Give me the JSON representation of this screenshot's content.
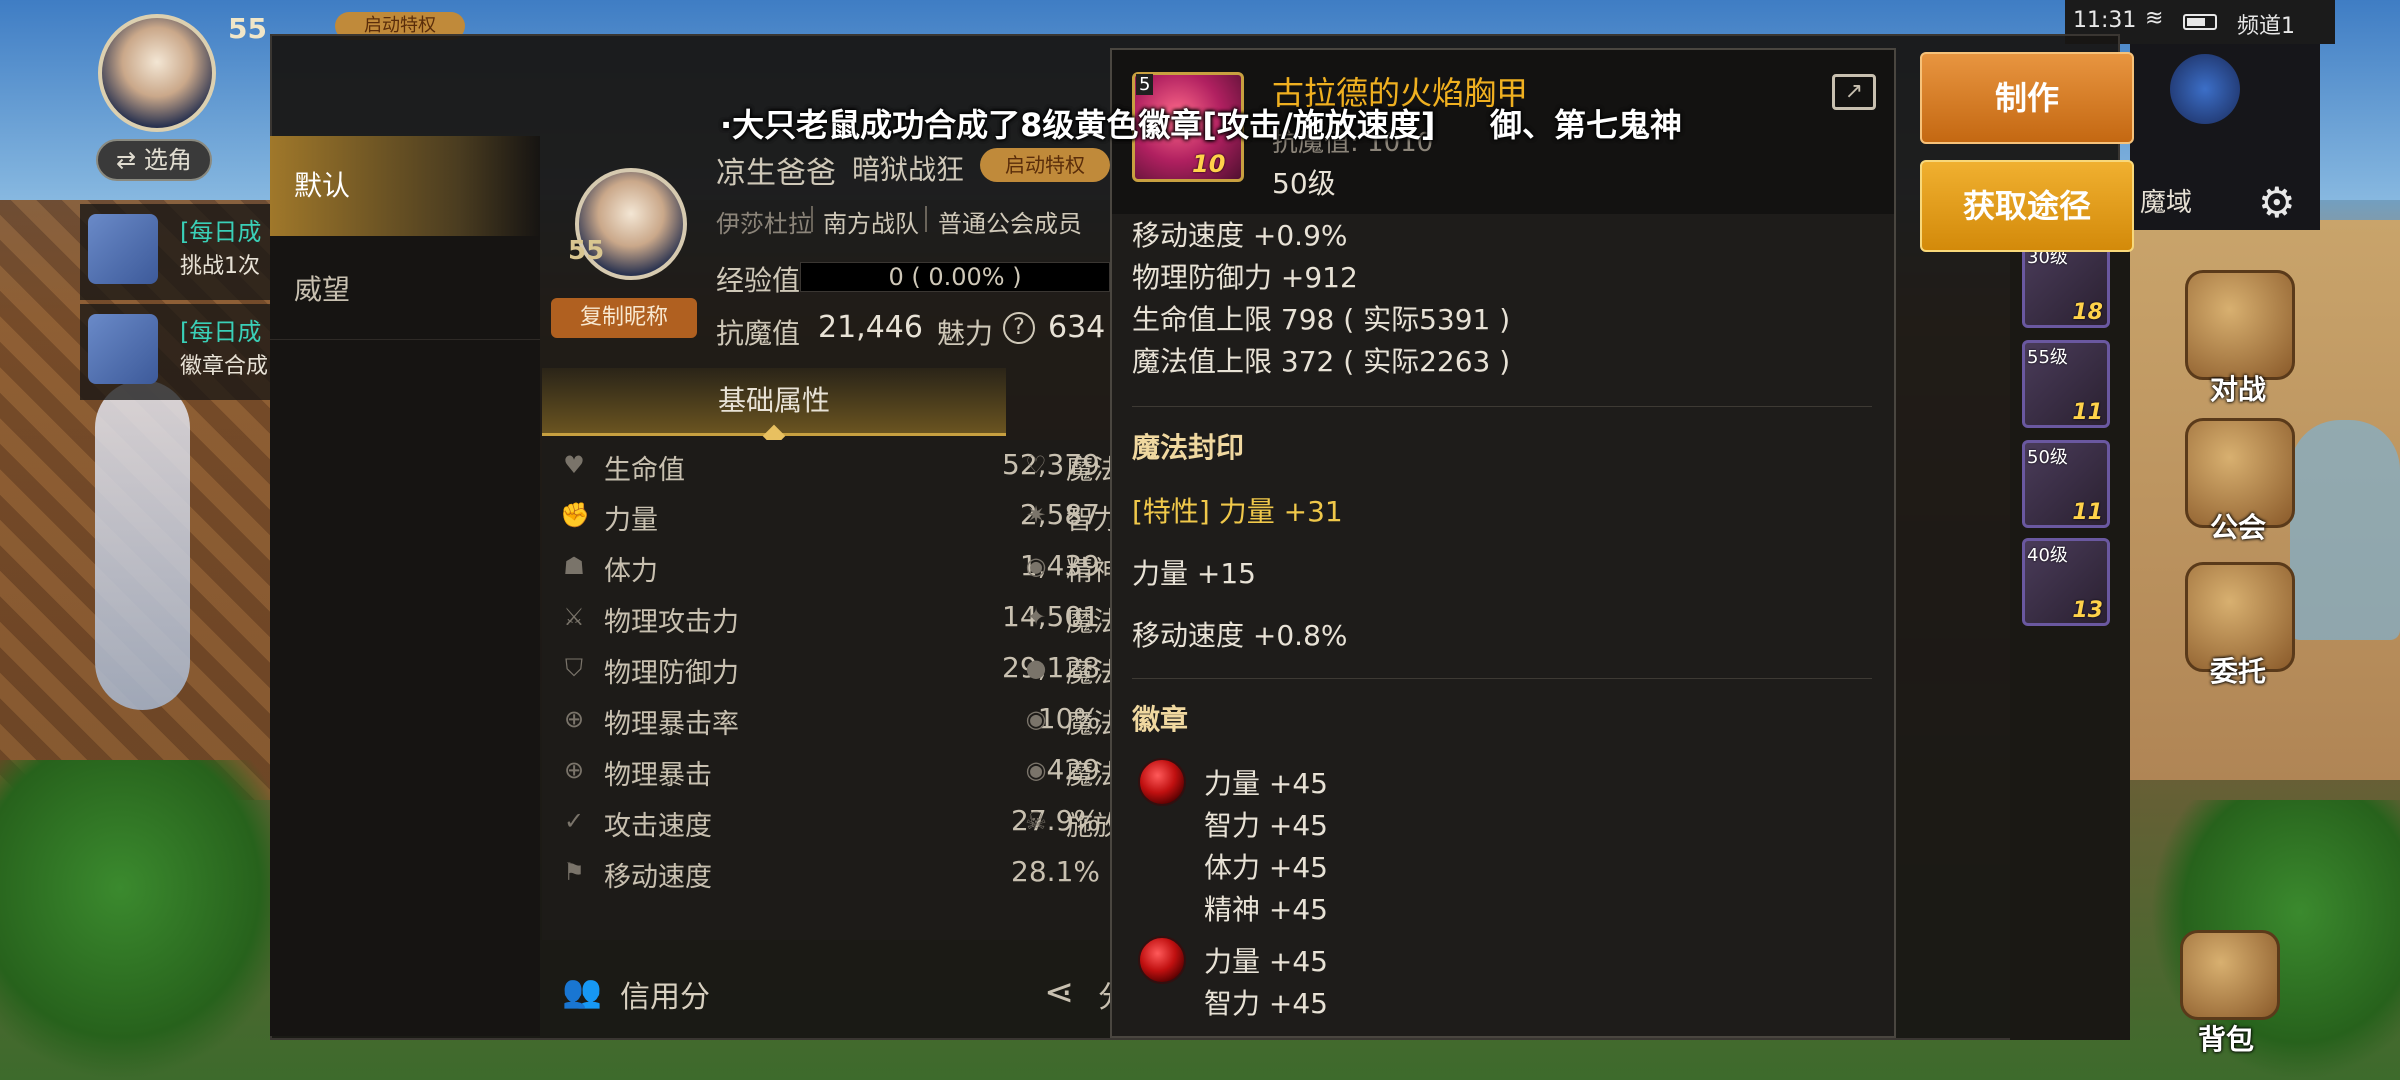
{
  "hud": {
    "level": "55",
    "badge": "启动特权",
    "select_label": "⇄ 选角",
    "quests": [
      {
        "title": "[每日成",
        "desc": "挑战1次"
      },
      {
        "title": "[每日成",
        "desc": "徽章合成"
      }
    ]
  },
  "status_bar": {
    "time": "11:31",
    "channel": "频道1"
  },
  "right_hud": {
    "region": "魔域"
  },
  "menu": {
    "battle": "对战",
    "guild": "公会",
    "commission": "委托",
    "bag": "背包"
  },
  "actions": {
    "make": "制作",
    "source": "获取途径"
  },
  "equipment": [
    {
      "level": "30级",
      "count": "18"
    },
    {
      "level": "55级",
      "count": "11"
    },
    {
      "level": "50级",
      "count": "11"
    },
    {
      "level": "40级",
      "count": "13"
    }
  ],
  "tabs": {
    "default": "默认",
    "prestige": "威望"
  },
  "character": {
    "level": "55",
    "copy_name": "复制昵称",
    "name": "凉生爸爸",
    "class": "暗狱战狂",
    "tag": "启动特权",
    "server": "伊莎杜拉",
    "team": "南方战队",
    "guild_role": "普通公会成员",
    "exp_label": "经验值",
    "exp_text": "0 ( 0.00% )",
    "exp_progress": 0,
    "resist_label": "抗魔值",
    "resist_value": "21,446",
    "charm_label": "魅力",
    "charm_value": "634"
  },
  "base_attr_tab": "基础属性",
  "stats_left": [
    {
      "name": "生命值",
      "value": "52,379",
      "icon": "heart-icon"
    },
    {
      "name": "力量",
      "value": "2,587",
      "icon": "fist-icon"
    },
    {
      "name": "体力",
      "value": "1,439",
      "icon": "body-icon"
    },
    {
      "name": "物理攻击力",
      "value": "14,501",
      "icon": "sword-icon"
    },
    {
      "name": "物理防御力",
      "value": "29,128",
      "icon": "shield-icon"
    },
    {
      "name": "物理暴击率",
      "value": "10%",
      "icon": "crosshair-icon"
    },
    {
      "name": "物理暴击",
      "value": "429",
      "icon": "crosshair-icon"
    },
    {
      "name": "攻击速度",
      "value": "27.9%",
      "icon": "blade-icon"
    },
    {
      "name": "移动速度",
      "value": "28.1%",
      "icon": "boot-icon"
    }
  ],
  "stats_right": [
    {
      "name": "魔法",
      "icon": "heart-outline-icon"
    },
    {
      "name": "智力",
      "icon": "spark-icon"
    },
    {
      "name": "精神",
      "icon": "circle-icon"
    },
    {
      "name": "魔法",
      "icon": "star-icon"
    },
    {
      "name": "魔法",
      "icon": "orb-icon"
    },
    {
      "name": "魔法",
      "icon": "circle-icon"
    },
    {
      "name": "魔法",
      "icon": "circle-icon"
    },
    {
      "name": "施放",
      "icon": "skull-icon"
    }
  ],
  "footer": {
    "credit": "信用分",
    "share": "分"
  },
  "tooltip": {
    "item_level_tag": "5",
    "item_count": "10",
    "title": "古拉德的火焰胸甲",
    "sub": "抗魔值: 1010",
    "level": "50级",
    "lines": [
      "移动速度 +0.9%",
      "物理防御力 +912",
      "生命值上限 798 ( 实际5391 )",
      "魔法值上限 372 ( 实际2263 )"
    ],
    "seal_title": "魔法封印",
    "seal_lines": [
      {
        "text": "[特性] 力量 +31",
        "gold": true
      },
      {
        "text": "力量 +15",
        "gold": false
      },
      {
        "text": "移动速度 +0.8%",
        "gold": false
      }
    ],
    "emblem_title": "徽章",
    "emblem1": [
      "力量 +45",
      "智力 +45",
      "体力 +45",
      "精神 +45"
    ],
    "emblem2": [
      "力量 +45",
      "智力 +45"
    ]
  },
  "broadcast": {
    "main": "·大只老鼠成功合成了8级黄色徽章[攻击/施放速度]",
    "tail": "御、第七鬼神"
  }
}
